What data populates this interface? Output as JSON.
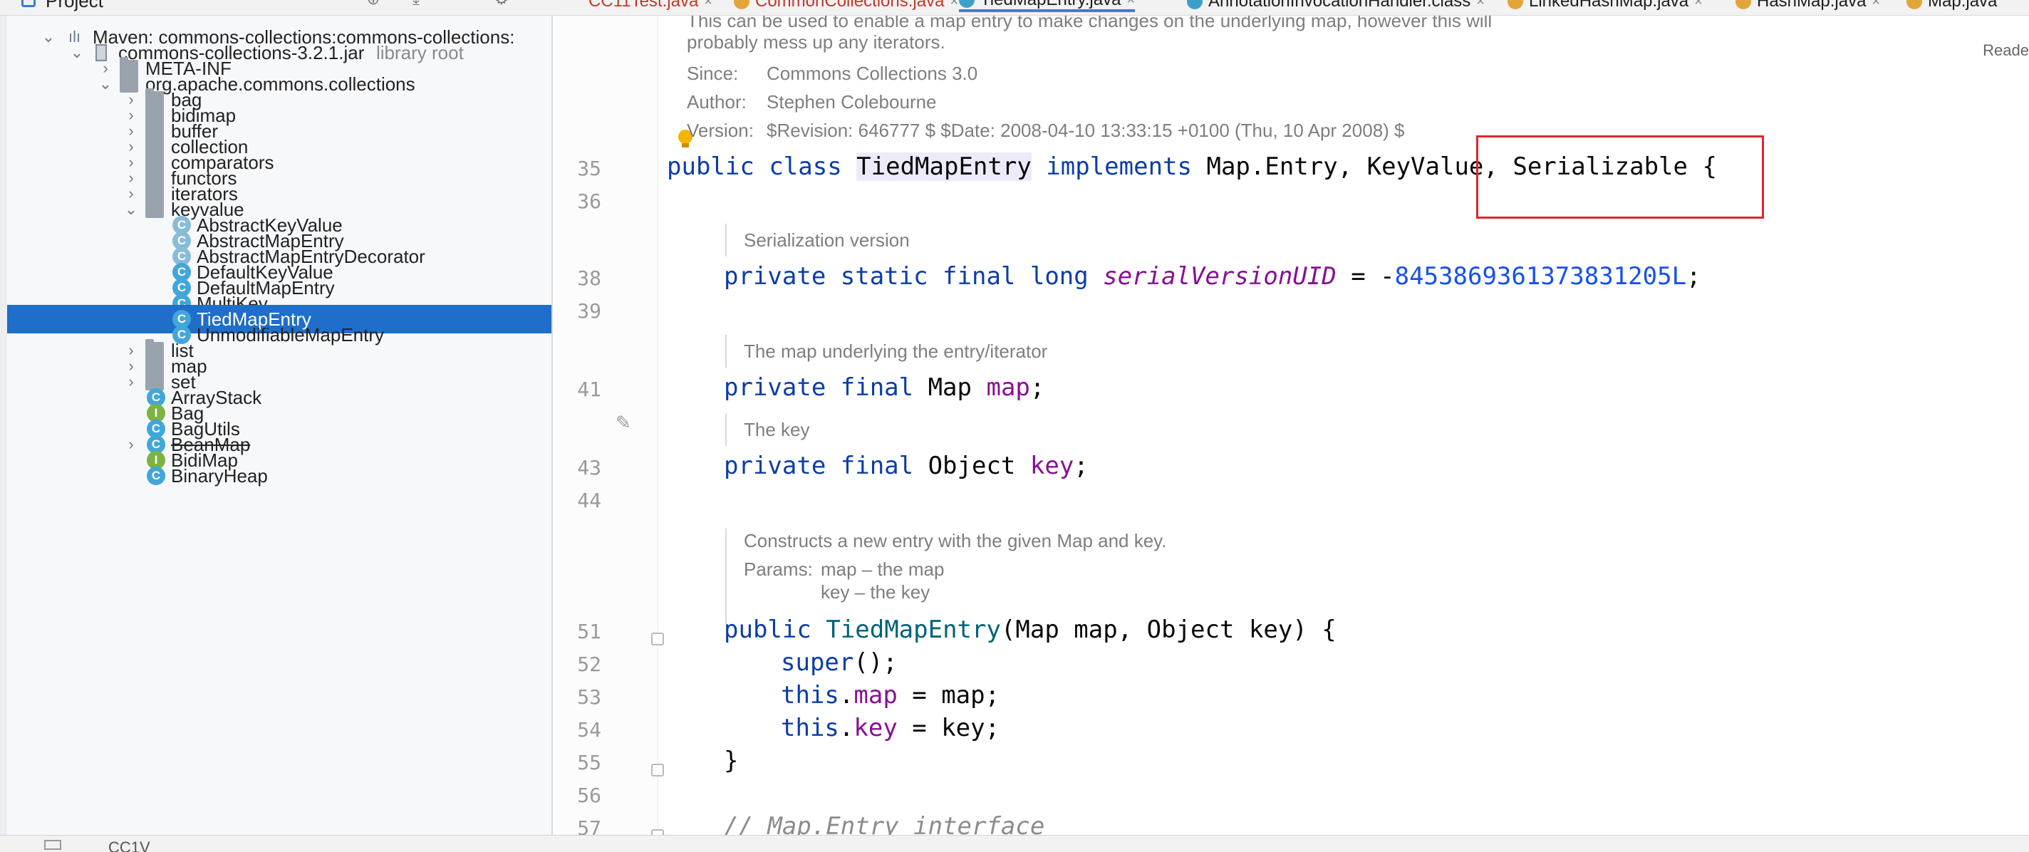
{
  "project_panel": {
    "title": "Project"
  },
  "tabs": [
    {
      "label": "CC11Test.java",
      "state": "error"
    },
    {
      "label": "CommonCollections.java",
      "state": "error"
    },
    {
      "label": "TiedMapEntry.java",
      "state": "active"
    },
    {
      "label": "AnnotationInvocationHandler.class",
      "state": "normal"
    },
    {
      "label": "LinkedHashMap.java",
      "state": "normal"
    },
    {
      "label": "HashMap.java",
      "state": "normal"
    },
    {
      "label": "Map.java",
      "state": "normal"
    }
  ],
  "tree": {
    "maven_root": "Maven: commons-collections:commons-collections:",
    "jar": {
      "label": "commons-collections-3.2.1.jar",
      "hint": "library root"
    },
    "meta_inf": "META-INF",
    "package": "org.apache.commons.collections",
    "subpackages_before": [
      "bag",
      "bidimap",
      "buffer",
      "collection",
      "comparators",
      "functors",
      "iterators"
    ],
    "keyvalue": "keyvalue",
    "keyvalue_classes": [
      {
        "label": "AbstractKeyValue",
        "kind": "abstract"
      },
      {
        "label": "AbstractMapEntry",
        "kind": "abstract"
      },
      {
        "label": "AbstractMapEntryDecorator",
        "kind": "abstract"
      },
      {
        "label": "DefaultKeyValue",
        "kind": "class"
      },
      {
        "label": "DefaultMapEntry",
        "kind": "class"
      },
      {
        "label": "MultiKey",
        "kind": "class"
      },
      {
        "label": "TiedMapEntry",
        "kind": "class",
        "selected": true
      },
      {
        "label": "UnmodifiableMapEntry",
        "kind": "class"
      }
    ],
    "subpackages_after": [
      "list",
      "map",
      "set"
    ],
    "root_classes": [
      {
        "label": "ArrayStack",
        "kind": "class"
      },
      {
        "label": "Bag",
        "kind": "interface"
      },
      {
        "label": "BagUtils",
        "kind": "class"
      },
      {
        "label": "BeanMap",
        "kind": "class",
        "deprecated": true
      },
      {
        "label": "BidiMap",
        "kind": "interface"
      },
      {
        "label": "BinaryHeap",
        "kind": "class"
      }
    ]
  },
  "editor": {
    "reader_mode": "Reade",
    "doc_top": {
      "line1": "This can be used to enable a map entry to make changes on the underlying map, however this will",
      "line2": "probably mess up any iterators.",
      "since_label": "Since:",
      "since_value": "Commons Collections 3.0",
      "author_label": "Author:",
      "author_value": "Stephen Colebourne",
      "version_label": "Version:",
      "version_value": "$Revision: 646777 $ $Date: 2008-04-10 13:33:15 +0100 (Thu, 10 Apr 2008) $"
    },
    "line_numbers": [
      "35",
      "36",
      "38",
      "39",
      "41",
      "43",
      "44",
      "51",
      "52",
      "53",
      "54",
      "55",
      "56",
      "57"
    ],
    "code": {
      "l35_public": "public",
      "l35_class": "class",
      "l35_name": "TiedMapEntry",
      "l35_implements": "implements",
      "l35_types": "Map.Entry, KeyValue,",
      "l35_serializable": "Serializable {",
      "doc_serialization": "Serialization version",
      "l38_mods": "private static final long",
      "l38_field": "serialVersionUID",
      "l38_eq": " = -",
      "l38_value": "8453869361373831205L",
      "l38_end": ";",
      "doc_map": "The map underlying the entry/iterator",
      "l41_mods": "private final",
      "l41_type": " Map ",
      "l41_field": "map",
      "l41_end": ";",
      "doc_key": "The key",
      "l43_mods": "private final",
      "l43_type": " Object ",
      "l43_field": "key",
      "l43_end": ";",
      "doc_ctor": "Constructs a new entry with the given Map and key.",
      "doc_params_label": "Params:",
      "doc_param1": "map – the map",
      "doc_param2": "key – the key",
      "l51_public": "public",
      "l51_name": "TiedMapEntry",
      "l51_rest": "(Map map, Object key) {",
      "l52_super": "super",
      "l52_rest": "();",
      "l53_this": "this",
      "l53_dot": ".",
      "l53_field": "map",
      "l53_rest": " = map;",
      "l54_this": "this",
      "l54_dot": ".",
      "l54_field": "key",
      "l54_rest": " = key;",
      "l55": "}",
      "l57_comment": "// Map.Entry interface"
    }
  },
  "status_bar": {
    "text": "CC1V"
  },
  "colors": {
    "selection": "#1f6ec9",
    "keyword": "#0b3da8",
    "field": "#871094",
    "number": "#1750eb",
    "highlight_box": "#e0262e"
  }
}
